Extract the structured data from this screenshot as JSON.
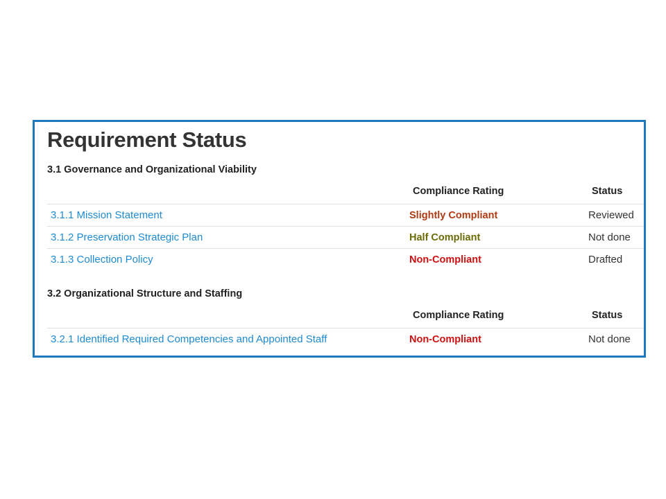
{
  "page": {
    "title": "Requirement Status",
    "border_color": "#1e78bd",
    "link_color": "#1e8ad2"
  },
  "rating_colors": {
    "Slightly Compliant": "#b03a12",
    "Half Compliant": "#6b6b06",
    "Non-Compliant": "#cc1010"
  },
  "columns": {
    "rating": "Compliance Rating",
    "status": "Status"
  },
  "sections": [
    {
      "heading": "3.1 Governance and Organizational Viability",
      "rows": [
        {
          "requirement": "3.1.1 Mission Statement",
          "rating": "Slightly Compliant",
          "status": "Reviewed"
        },
        {
          "requirement": "3.1.2 Preservation Strategic Plan",
          "rating": "Half Compliant",
          "status": "Not done"
        },
        {
          "requirement": "3.1.3 Collection Policy",
          "rating": "Non-Compliant",
          "status": "Drafted"
        }
      ]
    },
    {
      "heading": "3.2 Organizational Structure and Staffing",
      "rows": [
        {
          "requirement": "3.2.1 Identified Required Competencies and Appointed Staff",
          "rating": "Non-Compliant",
          "status": "Not done"
        }
      ]
    }
  ]
}
